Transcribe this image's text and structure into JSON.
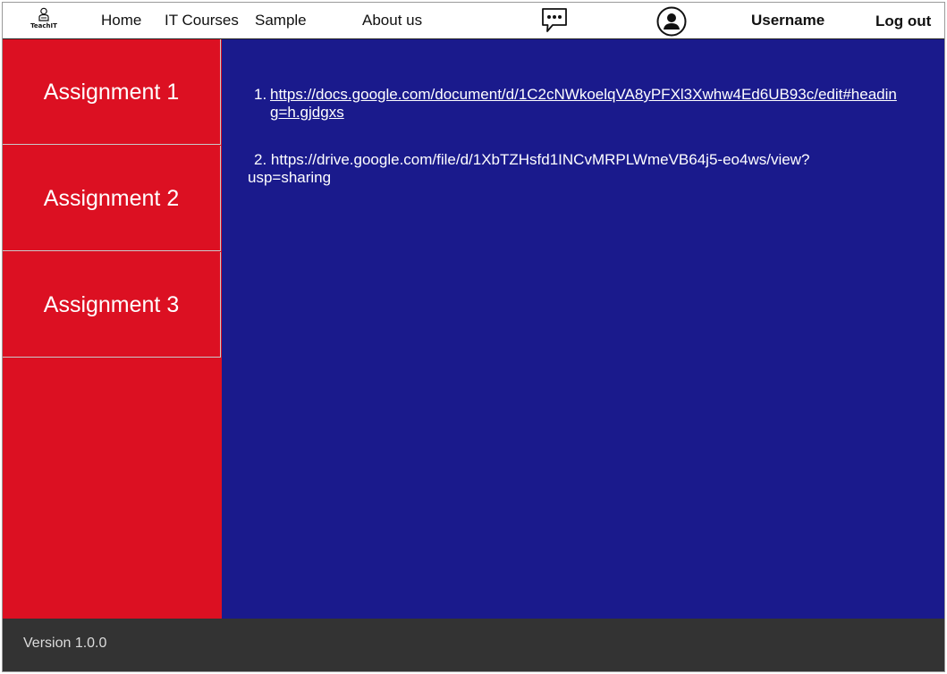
{
  "header": {
    "logo_text": "TeachIT",
    "nav": {
      "home": "Home",
      "it_courses": "IT Courses",
      "sample": "Sample",
      "about_us": "About us"
    },
    "username": "Username",
    "logout": "Log out",
    "icons": {
      "logo": "teacher-icon",
      "chat": "chat-bubble-icon",
      "profile": "user-profile-icon"
    }
  },
  "sidebar": {
    "items": [
      {
        "label": "Assignment 1"
      },
      {
        "label": "Assignment 2"
      },
      {
        "label": "Assignment 3"
      }
    ]
  },
  "main": {
    "links": [
      {
        "number": "1.",
        "url": "https://docs.google.com/document/d/1C2cNWkoelqVA8yPFXl3Xwhw4Ed6UB93c/edit#heading=h.gjdgxs"
      },
      {
        "number": "2.",
        "url": "https://drive.google.com/file/d/1XbTZHsfd1INCvMRPLWmeVB64j5-eo4ws/view?usp=sharing"
      }
    ]
  },
  "footer": {
    "version": "Version 1.0.0"
  },
  "colors": {
    "sidebar": "#dc1022",
    "main": "#1a1a8c",
    "footer": "#333333"
  }
}
